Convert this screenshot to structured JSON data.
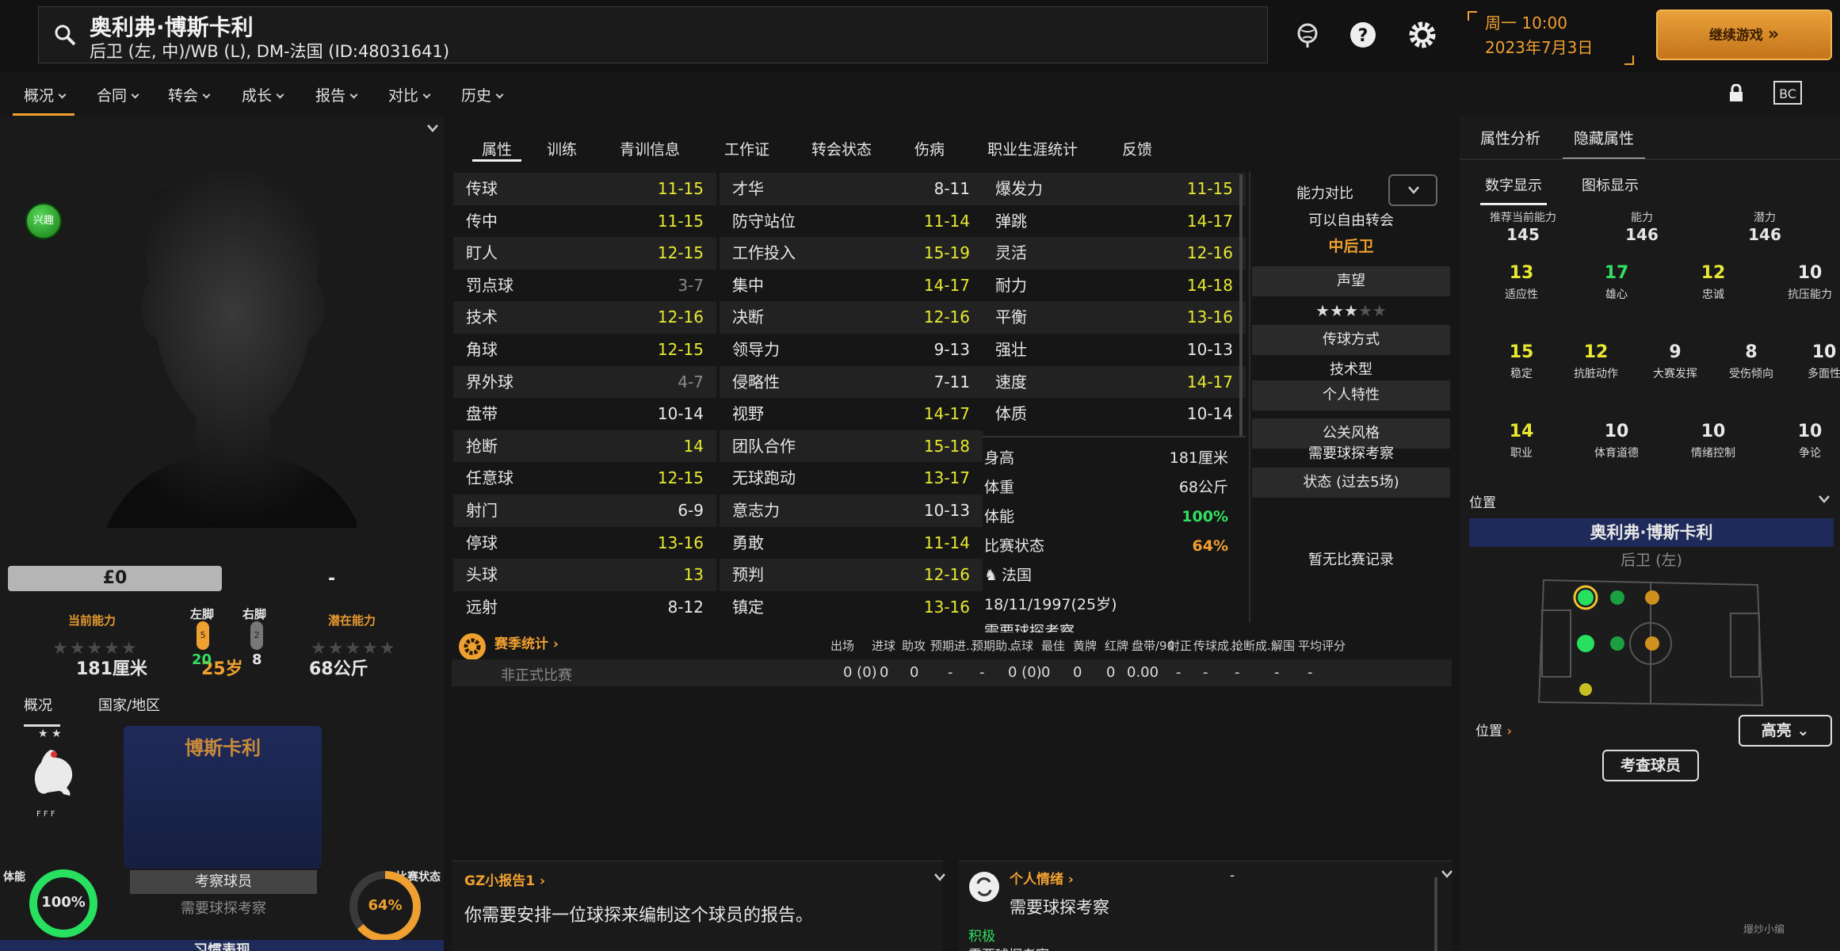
{
  "player": {
    "name": "奥利弗·博斯卡利",
    "subtitle": "后卫 (左, 中)/WB (L), DM-法国 (ID:48031641)"
  },
  "topbar": {
    "day_time": "周一 10:00",
    "date": "2023年7月3日",
    "continue_label": "继续游戏"
  },
  "menu": [
    "概况",
    "合同",
    "转会",
    "成长",
    "报告",
    "对比",
    "历史"
  ],
  "left": {
    "height": "181厘米",
    "age": "25岁",
    "weight": "68公斤",
    "value": "£0",
    "wage": "-",
    "current_ability": "当前能力",
    "potential_ability": "潜在能力",
    "left_foot": "左脚",
    "right_foot": "右脚",
    "left_foot_val": "20",
    "right_foot_val": "8",
    "left_foot_badge": "5",
    "right_foot_badge": "2",
    "mood": "兴趣",
    "tab_overview": "概况",
    "tab_nation": "国家/地区",
    "club_card_name": "博斯卡利",
    "scout_btn": "考察球员",
    "scout_need": "需要球探考察",
    "fitness_lbl": "体能",
    "fitness_val": "100%",
    "form_lbl": "比赛状态",
    "form_val": "64%",
    "bottom_text": "习惯表现",
    "fff": "F F F"
  },
  "tabs": [
    "属性",
    "训练",
    "青训信息",
    "工作证",
    "转会状态",
    "伤病",
    "职业生涯统计",
    "反馈"
  ],
  "attributes": {
    "col1": [
      [
        "传球",
        "11-15",
        "yel"
      ],
      [
        "传中",
        "11-15",
        "yel"
      ],
      [
        "盯人",
        "12-15",
        "yel"
      ],
      [
        "罚点球",
        "3-7",
        "gry"
      ],
      [
        "技术",
        "12-16",
        "yel"
      ],
      [
        "角球",
        "12-15",
        "yel"
      ],
      [
        "界外球",
        "4-7",
        "gry"
      ],
      [
        "盘带",
        "10-14",
        "whi"
      ],
      [
        "抢断",
        "14",
        "yel"
      ],
      [
        "任意球",
        "12-15",
        "yel"
      ],
      [
        "射门",
        "6-9",
        "whi"
      ],
      [
        "停球",
        "13-16",
        "yel"
      ],
      [
        "头球",
        "13",
        "yel"
      ],
      [
        "远射",
        "8-12",
        "whi"
      ]
    ],
    "col2": [
      [
        "才华",
        "8-11",
        "whi"
      ],
      [
        "防守站位",
        "11-14",
        "yel"
      ],
      [
        "工作投入",
        "15-19",
        "yel"
      ],
      [
        "集中",
        "14-17",
        "yel"
      ],
      [
        "决断",
        "12-16",
        "yel"
      ],
      [
        "领导力",
        "9-13",
        "whi"
      ],
      [
        "侵略性",
        "7-11",
        "whi"
      ],
      [
        "视野",
        "14-17",
        "yel"
      ],
      [
        "团队合作",
        "15-18",
        "yel"
      ],
      [
        "无球跑动",
        "13-17",
        "yel"
      ],
      [
        "意志力",
        "10-13",
        "whi"
      ],
      [
        "勇敢",
        "11-14",
        "yel"
      ],
      [
        "预判",
        "12-16",
        "yel"
      ],
      [
        "镇定",
        "13-16",
        "yel"
      ]
    ],
    "col3": [
      [
        "爆发力",
        "11-15",
        "yel"
      ],
      [
        "弹跳",
        "14-17",
        "yel"
      ],
      [
        "灵活",
        "12-16",
        "yel"
      ],
      [
        "耐力",
        "14-18",
        "yel"
      ],
      [
        "平衡",
        "13-16",
        "yel"
      ],
      [
        "强壮",
        "10-13",
        "whi"
      ],
      [
        "速度",
        "14-17",
        "yel"
      ],
      [
        "体质",
        "10-14",
        "whi"
      ]
    ]
  },
  "info": {
    "height_lbl": "身高",
    "height": "181厘米",
    "weight_lbl": "体重",
    "weight": "68公斤",
    "fitness_lbl": "体能",
    "fitness": "100%",
    "form_lbl": "比赛状态",
    "form": "64%",
    "nation": "法国",
    "dob": "18/11/1997(25岁)",
    "need": "需要球探考察"
  },
  "side": {
    "compare": "能力对比",
    "free": "可以自由转会",
    "role": "中后卫",
    "reputation": "声望",
    "rep_stars": "★★★",
    "rep_empty": "★★",
    "pass_style": "传球方式",
    "pass_val": "技术型",
    "traits": "个人特性",
    "pr": "公关风格",
    "pr_val": "需要球探考察",
    "form5": "状态 (过去5场)",
    "nomatch": "暂无比赛记录"
  },
  "stats": {
    "title": "赛季统计",
    "row_label": "非正式比赛",
    "headers": [
      "出场",
      "进球",
      "助攻",
      "预期进...",
      "预期助...",
      "点球",
      "最佳",
      "黄牌",
      "红牌",
      "盘带/90",
      "射正",
      "传球成...",
      "抢断成...",
      "解围",
      "平均评分"
    ],
    "values": [
      "0 (0)",
      "0",
      "0",
      "-",
      "-",
      "0 (0)",
      "0",
      "0",
      "0",
      "0.00",
      "-",
      "-",
      "-",
      "-",
      "-"
    ]
  },
  "report": {
    "title": "GZ小报告1",
    "text": "你需要安排一位球探来编制这个球员的报告。"
  },
  "emotion": {
    "title": "个人情绪",
    "text": "需要球探考察",
    "dash": "-",
    "level": "积极",
    "more": "需要球探考察"
  },
  "right": {
    "tab1": "属性分析",
    "tab2": "隐藏属性",
    "sub1": "数字显示",
    "sub2": "图标显示",
    "top": [
      [
        "推荐当前能力",
        "145"
      ],
      [
        "能力",
        "146"
      ],
      [
        "潜力",
        "146"
      ]
    ],
    "grid": [
      [
        "13",
        "适应性",
        "yel",
        "whi"
      ],
      [
        "17",
        "雄心",
        "grn",
        "whi"
      ],
      [
        "12",
        "忠诚",
        "yel",
        "whi"
      ],
      [
        "10",
        "抗压能力",
        "whi",
        "whi"
      ],
      [
        "15",
        "稳定",
        "yel",
        "whi"
      ],
      [
        "12",
        "抗脏动作",
        "yel",
        "red"
      ],
      [
        "9",
        "大赛发挥",
        "whi",
        "whi"
      ],
      [
        "8",
        "受伤倾向",
        "whi",
        "red"
      ],
      [
        "10",
        "多面性",
        "whi",
        "whi"
      ],
      [
        "14",
        "职业",
        "yel",
        "whi"
      ],
      [
        "10",
        "体育道德",
        "whi",
        "whi"
      ],
      [
        "10",
        "情绪控制",
        "whi",
        "whi"
      ],
      [
        "10",
        "争论",
        "whi",
        "red"
      ]
    ],
    "pos_title": "位置",
    "pos_name": "奥利弗·博斯卡利",
    "pos_role": "后卫 (左)",
    "pos_link": "位置",
    "highlight": "高亮",
    "scout_btn": "考查球员"
  },
  "watermark": "爆炒小编"
}
